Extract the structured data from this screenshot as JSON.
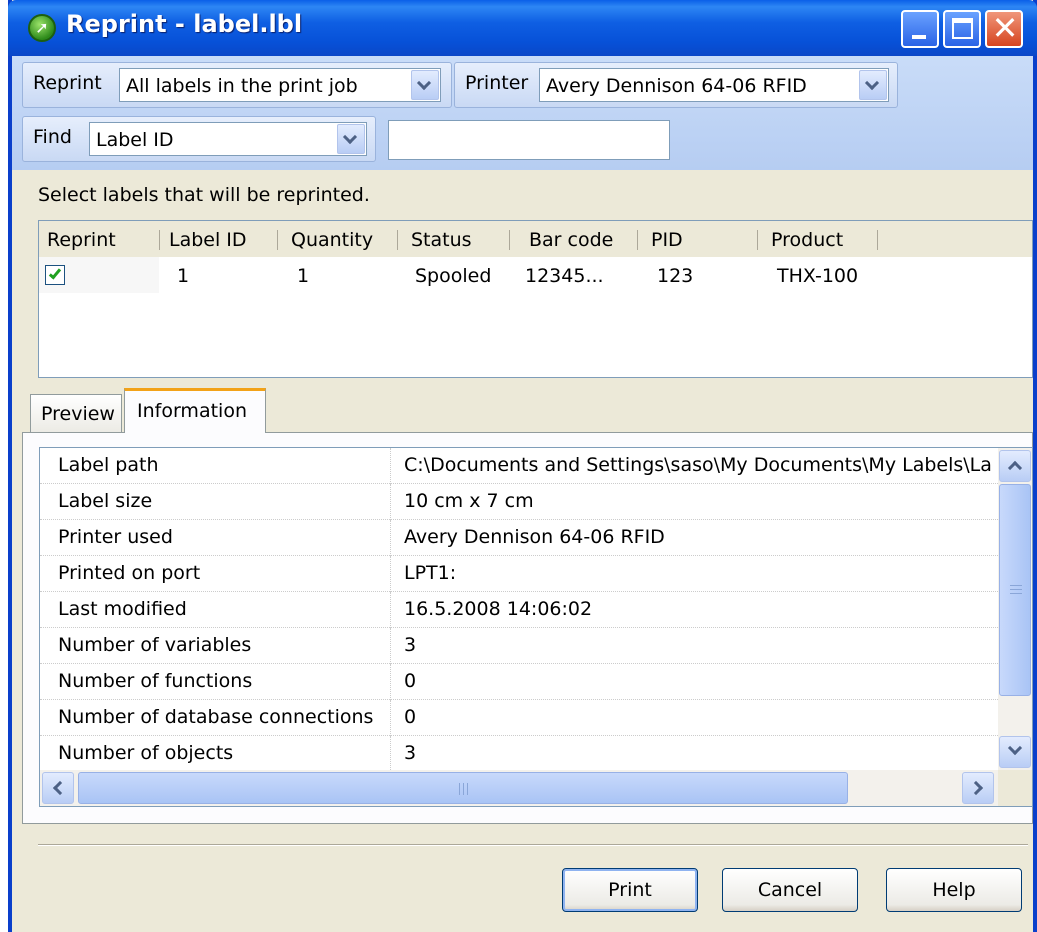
{
  "window": {
    "title": "Reprint - label.lbl"
  },
  "toolbar": {
    "reprint_label": "Reprint",
    "reprint_value": "All labels in the print job",
    "printer_label": "Printer",
    "printer_value": "Avery Dennison 64-06 RFID",
    "find_label": "Find",
    "find_value": "Label ID",
    "find_text": ""
  },
  "instruction": "Select labels that will be reprinted.",
  "labels_list": {
    "columns": [
      "Reprint",
      "Label ID",
      "Quantity",
      "Status",
      "Bar code",
      "PID",
      "Product"
    ],
    "rows": [
      {
        "reprint": true,
        "label_id": "1",
        "quantity": "1",
        "status": "Spooled",
        "bar_code": "12345...",
        "pid": "123",
        "product": "THX-100"
      }
    ]
  },
  "tabs": [
    {
      "label": "Preview",
      "active": false
    },
    {
      "label": "Information",
      "active": true
    }
  ],
  "information": [
    {
      "name": "Label path",
      "value": "C:\\Documents and Settings\\saso\\My Documents\\My Labels\\La"
    },
    {
      "name": "Label size",
      "value": "10 cm x 7 cm"
    },
    {
      "name": "Printer used",
      "value": "Avery Dennison 64-06 RFID"
    },
    {
      "name": "Printed on port",
      "value": "LPT1:"
    },
    {
      "name": "Last modified",
      "value": "16.5.2008 14:06:02"
    },
    {
      "name": "Number of variables",
      "value": "3"
    },
    {
      "name": "Number of functions",
      "value": "0"
    },
    {
      "name": "Number of database connections",
      "value": "0"
    },
    {
      "name": "Number of objects",
      "value": "3"
    }
  ],
  "buttons": {
    "print": "Print",
    "cancel": "Cancel",
    "help": "Help"
  },
  "icons": {
    "app": "app-icon",
    "minimize": "minimize-icon",
    "maximize": "maximize-icon",
    "close": "close-icon"
  },
  "colors": {
    "titlebar": "#0a5fe8",
    "window_bg": "#ece9d8",
    "active_tab_accent": "#f2a218",
    "checkmark": "#21a121"
  }
}
